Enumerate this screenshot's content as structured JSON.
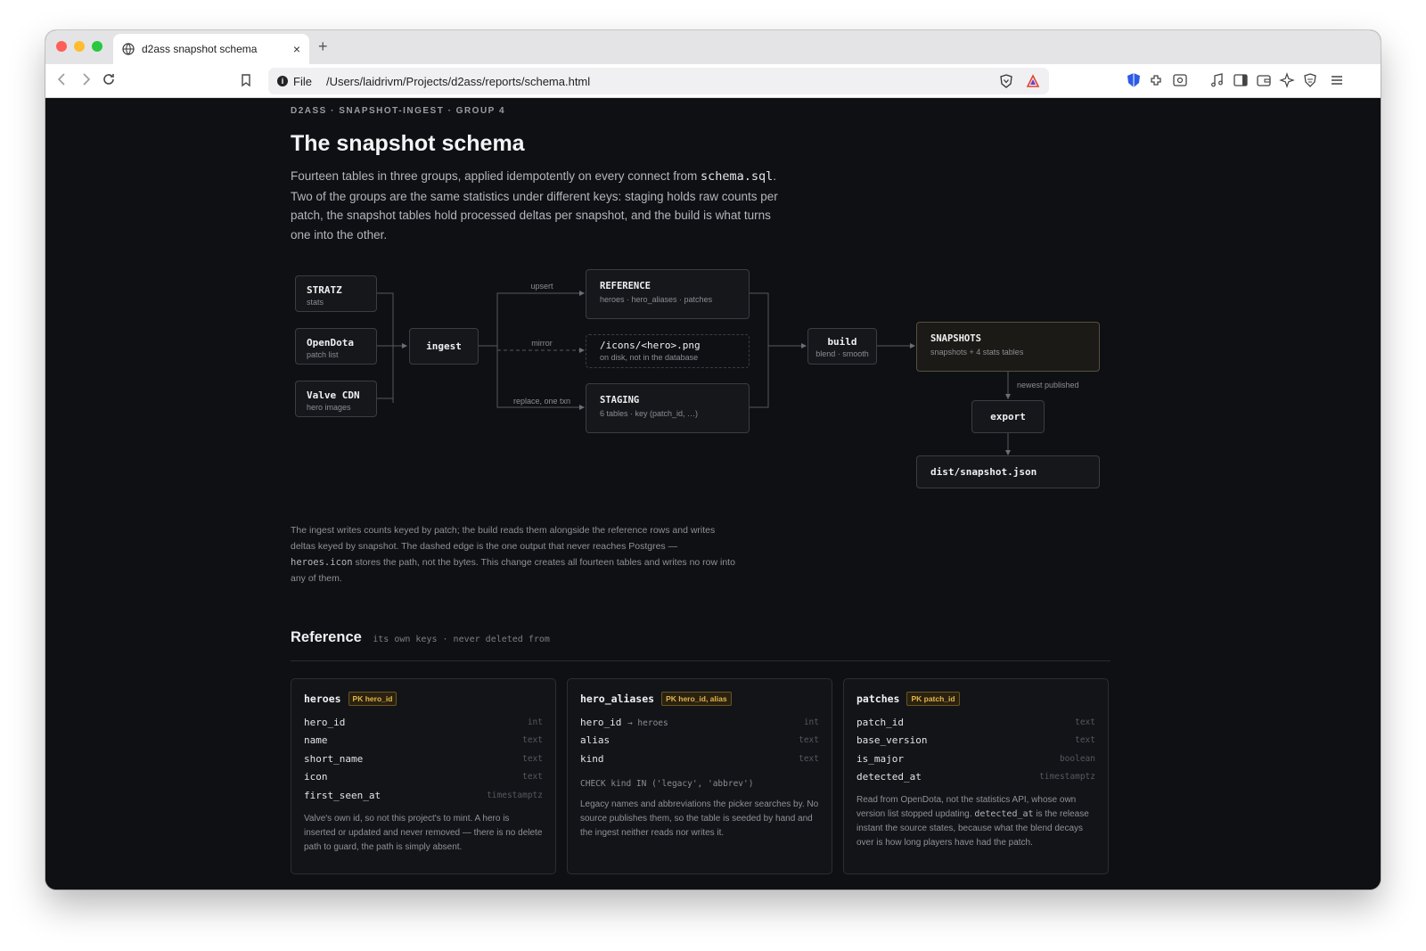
{
  "browser": {
    "tab_title": "d2ass snapshot schema",
    "close_glyph": "×",
    "new_tab_glyph": "+",
    "protocol_label": "File",
    "url": "/Users/laidrivm/Projects/d2ass/reports/schema.html",
    "colors": {
      "close": "#ff5f57",
      "minimize": "#febc2e",
      "zoom": "#28c840"
    }
  },
  "page": {
    "eyebrow": "D2ASS · SNAPSHOT-INGEST · GROUP 4",
    "title": "The snapshot schema",
    "lede_1": "Fourteen tables in three groups, applied idempotently on every connect from ",
    "lede_code": "schema.sql",
    "lede_2": ". Two of the groups are the same statistics under different keys: staging holds raw counts per patch, the snapshot tables hold processed deltas per snapshot, and the build is what turns one into the other.",
    "caption_1": "The ingest writes counts keyed by patch; the build reads them alongside the reference rows and writes deltas keyed by snapshot. The dashed edge is the one output that never reaches Postgres — ",
    "caption_code": "heroes.icon",
    "caption_2": " stores the path, not the bytes. This change creates all fourteen tables and writes no row into any of them."
  },
  "diagram": {
    "sources": [
      {
        "title": "STRATZ",
        "sub": "stats"
      },
      {
        "title": "OpenDota",
        "sub": "patch list"
      },
      {
        "title": "Valve CDN",
        "sub": "hero images"
      }
    ],
    "ingest": "ingest",
    "reference": {
      "title": "REFERENCE",
      "sub": "heroes · hero_aliases · patches"
    },
    "icons": {
      "title": "/icons/<hero>.png",
      "sub": "on disk, not in the database"
    },
    "staging": {
      "title": "STAGING",
      "sub": "6 tables · key (patch_id, …)"
    },
    "build": {
      "title": "build",
      "sub": "blend · smooth"
    },
    "snapshots": {
      "title": "SNAPSHOTS",
      "sub": "snapshots + 4 stats tables"
    },
    "export": "export",
    "dist": "dist/snapshot.json",
    "edge_labels": {
      "upsert": "upsert",
      "mirror": "mirror",
      "replace": "replace, one txn",
      "newest": "newest published"
    }
  },
  "reference_section": {
    "title": "Reference",
    "subtitle": "its own keys · never deleted from",
    "tables": [
      {
        "name": "heroes",
        "pk": "PK hero_id",
        "columns": [
          {
            "name": "hero_id",
            "type": "int"
          },
          {
            "name": "name",
            "type": "text"
          },
          {
            "name": "short_name",
            "type": "text"
          },
          {
            "name": "icon",
            "type": "text"
          },
          {
            "name": "first_seen_at",
            "type": "timestamptz"
          }
        ],
        "note": "Valve's own id, so not this project's to mint. A hero is inserted or updated and never removed — there is no delete path to guard, the path is simply absent."
      },
      {
        "name": "hero_aliases",
        "pk": "PK hero_id, alias",
        "columns": [
          {
            "name": "hero_id",
            "ref": "→ heroes",
            "type": "int"
          },
          {
            "name": "alias",
            "type": "text"
          },
          {
            "name": "kind",
            "type": "text"
          }
        ],
        "check": "CHECK kind IN ('legacy', 'abbrev')",
        "note": "Legacy names and abbreviations the picker searches by. No source publishes them, so the table is seeded by hand and the ingest neither reads nor writes it."
      },
      {
        "name": "patches",
        "pk": "PK patch_id",
        "columns": [
          {
            "name": "patch_id",
            "type": "text"
          },
          {
            "name": "base_version",
            "type": "text"
          },
          {
            "name": "is_major",
            "type": "boolean"
          },
          {
            "name": "detected_at",
            "type": "timestamptz"
          }
        ],
        "note_1": "Read from OpenDota, not the statistics API, whose own version list stopped updating. ",
        "note_code": "detected_at",
        "note_2": " is the release instant the source states, because what the blend decays over is how long players have had the patch."
      }
    ]
  }
}
